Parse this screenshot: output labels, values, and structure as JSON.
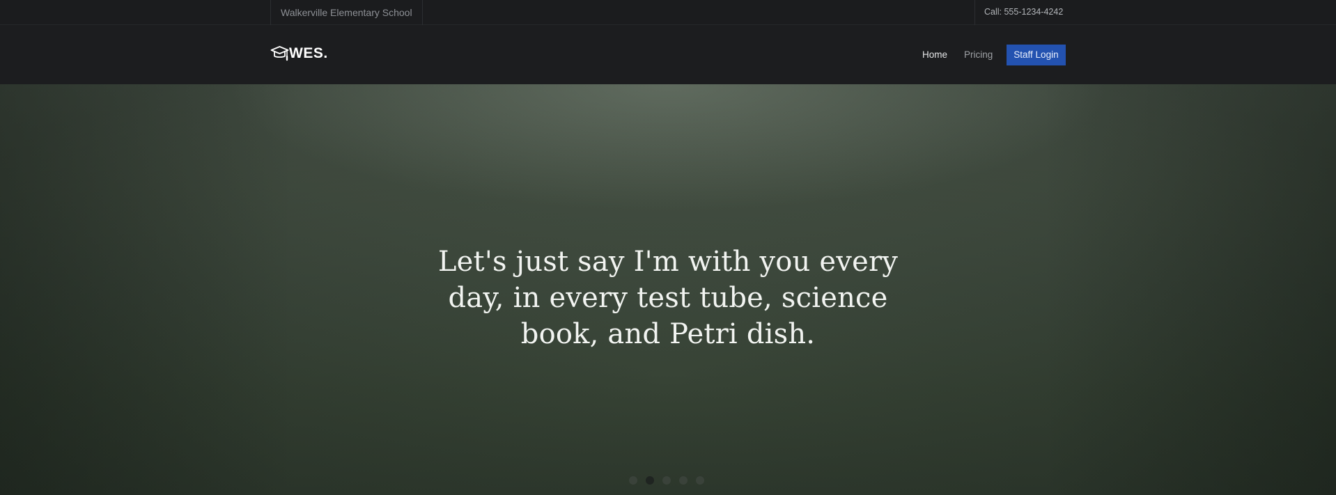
{
  "topbar": {
    "school_name": "Walkerville Elementary School",
    "phone": "Call: 555-1234-4242"
  },
  "navbar": {
    "logo_text": "WES.",
    "logo_icon": "graduation-cap-icon",
    "links": [
      {
        "label": "Home",
        "active": true
      },
      {
        "label": "Pricing",
        "active": false
      }
    ],
    "staff_login_label": "Staff Login"
  },
  "hero": {
    "quote": "Let's just say I'm with you every day, in every test tube, science book, and Petri dish.",
    "slide_count": 5,
    "active_slide": 2
  },
  "colors": {
    "topbar_bg": "#1b1c1e",
    "navbar_bg": "#1c1d1f",
    "accent_button": "#2352b0",
    "hero_green": "#4a5648"
  }
}
